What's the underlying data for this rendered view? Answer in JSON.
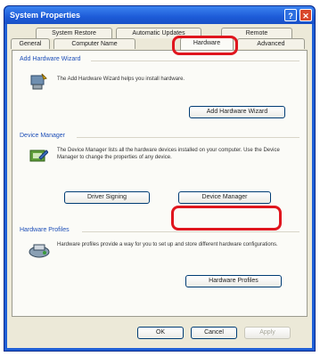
{
  "window": {
    "title": "System Properties",
    "help_label": "?",
    "close_label": "✕"
  },
  "tabs_back": [
    {
      "label": "System Restore"
    },
    {
      "label": "Automatic Updates"
    },
    {
      "label": "Remote"
    }
  ],
  "tabs_front": [
    {
      "label": "General"
    },
    {
      "label": "Computer Name"
    },
    {
      "label": "Hardware",
      "active": true
    },
    {
      "label": "Advanced"
    }
  ],
  "sections": {
    "add_hardware": {
      "title": "Add Hardware Wizard",
      "description": "The Add Hardware Wizard helps you install hardware.",
      "button_label": "Add Hardware Wizard",
      "icon": "add-hardware-wizard-icon"
    },
    "device_manager": {
      "title": "Device Manager",
      "description": "The Device Manager lists all the hardware devices installed on your computer. Use the Device Manager to change the properties of any device.",
      "driver_signing_label": "Driver Signing",
      "device_manager_label": "Device Manager",
      "icon": "device-manager-icon"
    },
    "hardware_profiles": {
      "title": "Hardware Profiles",
      "description": "Hardware profiles provide a way for you to set up and store different hardware configurations.",
      "button_label": "Hardware Profiles",
      "icon": "hardware-profiles-icon"
    }
  },
  "footer": {
    "ok_label": "OK",
    "cancel_label": "Cancel",
    "apply_label": "Apply"
  },
  "annotations": {
    "highlight_color": "#e0161e"
  }
}
